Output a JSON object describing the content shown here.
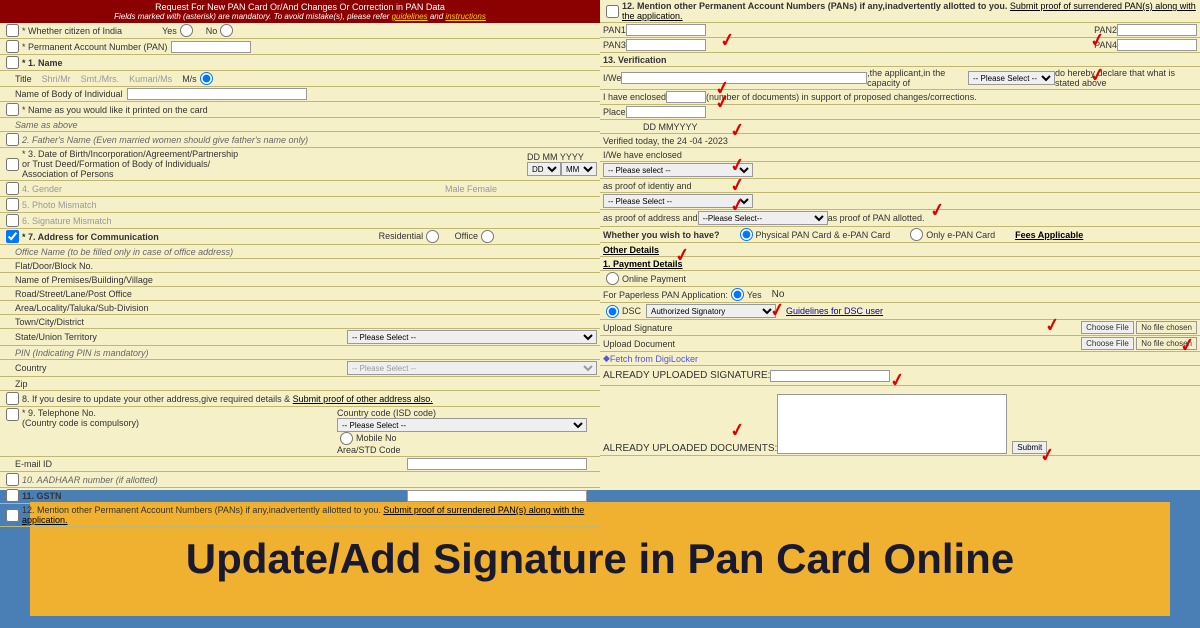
{
  "header": {
    "title": "Request For New PAN Card Or/And Changes Or Correction in PAN Data",
    "subtitle_prefix": "Fields marked with  (asterisk) are mandatory.  To avoid mistake(s), please refer ",
    "link1": "guidelines",
    "and": " and ",
    "link2": "instructions"
  },
  "left": {
    "citizen": "* Whether citizen of India",
    "yes": "Yes",
    "no": "No",
    "pan": "* Permanent Account Number (PAN)",
    "name": "* 1. Name",
    "title": "Title",
    "shri": "Shri/Mr",
    "smt": "Smt./Mrs.",
    "kumari": "Kumari/Ms",
    "ms": "M/s",
    "body": "Name of Body of Individual",
    "printed": "* Name as you would like it printed on the card",
    "same": "Same as above",
    "father": "2. Father's Name (Even married women should give father's name only)",
    "dob": "* 3. Date of Birth/Incorporation/Agreement/Partnership",
    "dob2": "or Trust Deed/Formation of Body of Individuals/",
    "dob3": "Association of Persons",
    "dd": "DD",
    "mm": "MM",
    "yyyy": "YYYY",
    "gender": "4. Gender",
    "male": "Male",
    "female": "Female",
    "photo": "5. Photo Mismatch",
    "sig": "6. Signature Mismatch",
    "addr": "* 7. Address for Communication",
    "res": "Residential",
    "off": "Office",
    "offname": "Office Name (to be filled only in case of office address)",
    "flat": "Flat/Door/Block No.",
    "premises": "Name of Premises/Building/Village",
    "road": "Road/Street/Lane/Post Office",
    "area": "Area/Locality/Taluka/Sub-Division",
    "town": "Town/City/District",
    "state": "State/Union Territory",
    "pleasesel": "-- Please Select --",
    "pin": "PIN (Indicating PIN is mandatory)",
    "country": "Country",
    "zip": "Zip",
    "s8": "8. If you desire to update your other address,give required details & ",
    "s8link": "Submit proof of other address also.",
    "s9": "* 9. Telephone No.",
    "s9b": "(Country code is compulsory)",
    "isd": "Country code (ISD code)",
    "mobile": "Mobile No",
    "std": "Area/STD Code",
    "email": "E-mail ID",
    "aadhaar": "10. AADHAAR number (if allotted)",
    "gstn": "11. GSTN",
    "s12": "12. Mention other Permanent Account Numbers (PANs) if any,inadvertently allotted to you. ",
    "s12link": "Submit proof of surrendered PAN(s) along with the application."
  },
  "right": {
    "s12": "12. Mention other Permanent Account Numbers (PANs) if any,inadvertently allotted to you. ",
    "s12link": "Submit proof of surrendered PAN(s) along with the application.",
    "pan1": "PAN1",
    "pan2": "PAN2",
    "pan3": "PAN3",
    "pan4": "PAN4",
    "s13": "13. Verification",
    "iwe": "I/We",
    "capacity": ",the applicant,in the capacity of ",
    "pleasesel": "-- Please Select --",
    "declare": "do hereby declare that what is stated above",
    "enclosed": "I have enclosed",
    "docs": "(number of documents) in support of proposed changes/corrections.",
    "place": "Place",
    "ddmmyyyy": "DD MMYYYY",
    "verified": "Verified today, the 24 -04 -2023",
    "weencl": "I/We have enclosed",
    "plsel": "-- Please select --",
    "proofid": "as proof of identiy and",
    "plsel2": "-- Please Select --",
    "proofaddr": "as proof of address and ",
    "plsel3": "--Please Select--",
    "proofpan": " as proof of PAN allotted.",
    "wish": "Whether you wish to have?",
    "phys": "Physical PAN Card & e-PAN Card",
    "epan": "Only e-PAN Card",
    "fees": "Fees Applicable",
    "other": "Other Details",
    "payment": "1. Payment Details",
    "online": "Online Payment",
    "paperless": "For Paperless PAN Application:",
    "yes": "Yes",
    "no": "No",
    "dsc": "DSC",
    "authsig": "Authorized Signatory",
    "dscguide": "Guidelines for DSC user",
    "upsig": "Upload Signature",
    "updoc": "Upload Document",
    "choose": "Choose File",
    "nofile": "No file chosen",
    "digi": "Fetch from DigiLocker",
    "alreadysig": "ALREADY UPLOADED SIGNATURE:",
    "alreadydoc": "ALREADY UPLOADED DOCUMENTS:",
    "submit": "Submit"
  },
  "banner": "Update/Add Signature in Pan Card Online"
}
